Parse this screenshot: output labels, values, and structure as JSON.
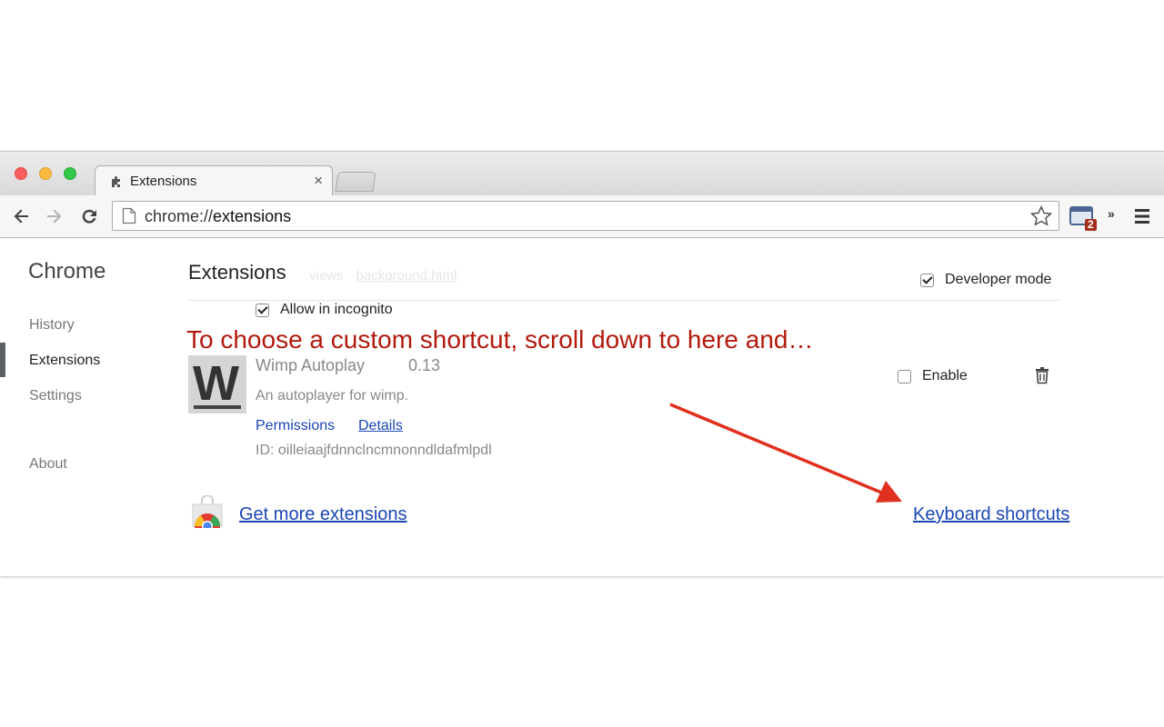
{
  "browser": {
    "tab": {
      "title": "Extensions",
      "close_glyph": "×"
    },
    "omnibox": {
      "scheme": "chrome://",
      "host": "extensions"
    },
    "extension_badge": "2",
    "overflow_glyph": "»"
  },
  "sidebar": {
    "title": "Chrome",
    "items": [
      {
        "label": "History"
      },
      {
        "label": "Extensions"
      },
      {
        "label": "Settings"
      },
      {
        "label": "About"
      }
    ]
  },
  "main": {
    "title": "Extensions",
    "ghost_text": "views",
    "ghost_link": "background.html",
    "developer_mode_label": "Developer mode",
    "developer_mode_checked": true,
    "allow_incognito_label": "Allow in incognito",
    "allow_incognito_checked": true,
    "annotation": "To choose a custom shortcut, scroll down to here and…",
    "annotation_color": "#b21a0d",
    "extension": {
      "icon_letter": "W",
      "name": "Wimp Autoplay",
      "version": "0.13",
      "description": "An autoplayer for wimp.",
      "permissions_label": "Permissions",
      "details_label": "Details",
      "id": "ID: oilleiaajfdnnclncmnonndldafmlpdl",
      "enable_label": "Enable",
      "enabled": false
    },
    "get_more_label": "Get more extensions",
    "keyboard_shortcuts_label": "Keyboard shortcuts"
  },
  "colors": {
    "link": "#1a46b4",
    "arrow": "#e0301e"
  }
}
